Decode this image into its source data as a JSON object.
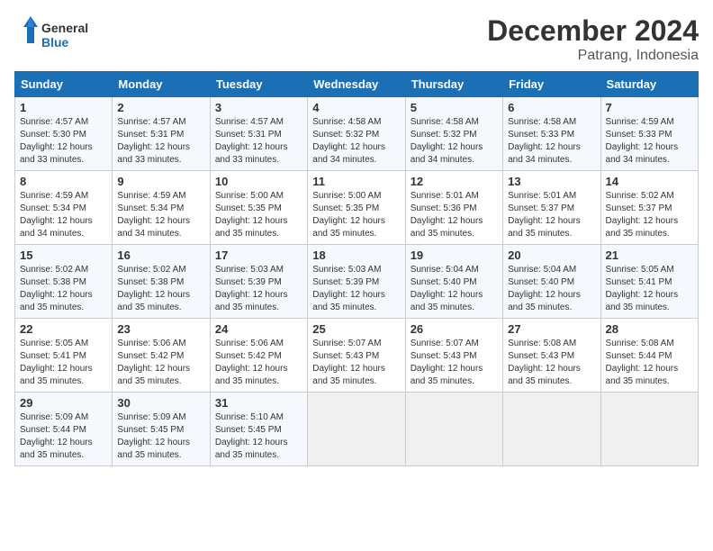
{
  "logo": {
    "general": "General",
    "blue": "Blue"
  },
  "header": {
    "title": "December 2024",
    "subtitle": "Patrang, Indonesia"
  },
  "weekdays": [
    "Sunday",
    "Monday",
    "Tuesday",
    "Wednesday",
    "Thursday",
    "Friday",
    "Saturday"
  ],
  "weeks": [
    [
      {
        "day": "1",
        "sunrise": "4:57 AM",
        "sunset": "5:30 PM",
        "daylight": "12 hours and 33 minutes."
      },
      {
        "day": "2",
        "sunrise": "4:57 AM",
        "sunset": "5:31 PM",
        "daylight": "12 hours and 33 minutes."
      },
      {
        "day": "3",
        "sunrise": "4:57 AM",
        "sunset": "5:31 PM",
        "daylight": "12 hours and 33 minutes."
      },
      {
        "day": "4",
        "sunrise": "4:58 AM",
        "sunset": "5:32 PM",
        "daylight": "12 hours and 34 minutes."
      },
      {
        "day": "5",
        "sunrise": "4:58 AM",
        "sunset": "5:32 PM",
        "daylight": "12 hours and 34 minutes."
      },
      {
        "day": "6",
        "sunrise": "4:58 AM",
        "sunset": "5:33 PM",
        "daylight": "12 hours and 34 minutes."
      },
      {
        "day": "7",
        "sunrise": "4:59 AM",
        "sunset": "5:33 PM",
        "daylight": "12 hours and 34 minutes."
      }
    ],
    [
      {
        "day": "8",
        "sunrise": "4:59 AM",
        "sunset": "5:34 PM",
        "daylight": "12 hours and 34 minutes."
      },
      {
        "day": "9",
        "sunrise": "4:59 AM",
        "sunset": "5:34 PM",
        "daylight": "12 hours and 34 minutes."
      },
      {
        "day": "10",
        "sunrise": "5:00 AM",
        "sunset": "5:35 PM",
        "daylight": "12 hours and 35 minutes."
      },
      {
        "day": "11",
        "sunrise": "5:00 AM",
        "sunset": "5:35 PM",
        "daylight": "12 hours and 35 minutes."
      },
      {
        "day": "12",
        "sunrise": "5:01 AM",
        "sunset": "5:36 PM",
        "daylight": "12 hours and 35 minutes."
      },
      {
        "day": "13",
        "sunrise": "5:01 AM",
        "sunset": "5:37 PM",
        "daylight": "12 hours and 35 minutes."
      },
      {
        "day": "14",
        "sunrise": "5:02 AM",
        "sunset": "5:37 PM",
        "daylight": "12 hours and 35 minutes."
      }
    ],
    [
      {
        "day": "15",
        "sunrise": "5:02 AM",
        "sunset": "5:38 PM",
        "daylight": "12 hours and 35 minutes."
      },
      {
        "day": "16",
        "sunrise": "5:02 AM",
        "sunset": "5:38 PM",
        "daylight": "12 hours and 35 minutes."
      },
      {
        "day": "17",
        "sunrise": "5:03 AM",
        "sunset": "5:39 PM",
        "daylight": "12 hours and 35 minutes."
      },
      {
        "day": "18",
        "sunrise": "5:03 AM",
        "sunset": "5:39 PM",
        "daylight": "12 hours and 35 minutes."
      },
      {
        "day": "19",
        "sunrise": "5:04 AM",
        "sunset": "5:40 PM",
        "daylight": "12 hours and 35 minutes."
      },
      {
        "day": "20",
        "sunrise": "5:04 AM",
        "sunset": "5:40 PM",
        "daylight": "12 hours and 35 minutes."
      },
      {
        "day": "21",
        "sunrise": "5:05 AM",
        "sunset": "5:41 PM",
        "daylight": "12 hours and 35 minutes."
      }
    ],
    [
      {
        "day": "22",
        "sunrise": "5:05 AM",
        "sunset": "5:41 PM",
        "daylight": "12 hours and 35 minutes."
      },
      {
        "day": "23",
        "sunrise": "5:06 AM",
        "sunset": "5:42 PM",
        "daylight": "12 hours and 35 minutes."
      },
      {
        "day": "24",
        "sunrise": "5:06 AM",
        "sunset": "5:42 PM",
        "daylight": "12 hours and 35 minutes."
      },
      {
        "day": "25",
        "sunrise": "5:07 AM",
        "sunset": "5:43 PM",
        "daylight": "12 hours and 35 minutes."
      },
      {
        "day": "26",
        "sunrise": "5:07 AM",
        "sunset": "5:43 PM",
        "daylight": "12 hours and 35 minutes."
      },
      {
        "day": "27",
        "sunrise": "5:08 AM",
        "sunset": "5:43 PM",
        "daylight": "12 hours and 35 minutes."
      },
      {
        "day": "28",
        "sunrise": "5:08 AM",
        "sunset": "5:44 PM",
        "daylight": "12 hours and 35 minutes."
      }
    ],
    [
      {
        "day": "29",
        "sunrise": "5:09 AM",
        "sunset": "5:44 PM",
        "daylight": "12 hours and 35 minutes."
      },
      {
        "day": "30",
        "sunrise": "5:09 AM",
        "sunset": "5:45 PM",
        "daylight": "12 hours and 35 minutes."
      },
      {
        "day": "31",
        "sunrise": "5:10 AM",
        "sunset": "5:45 PM",
        "daylight": "12 hours and 35 minutes."
      },
      null,
      null,
      null,
      null
    ]
  ]
}
